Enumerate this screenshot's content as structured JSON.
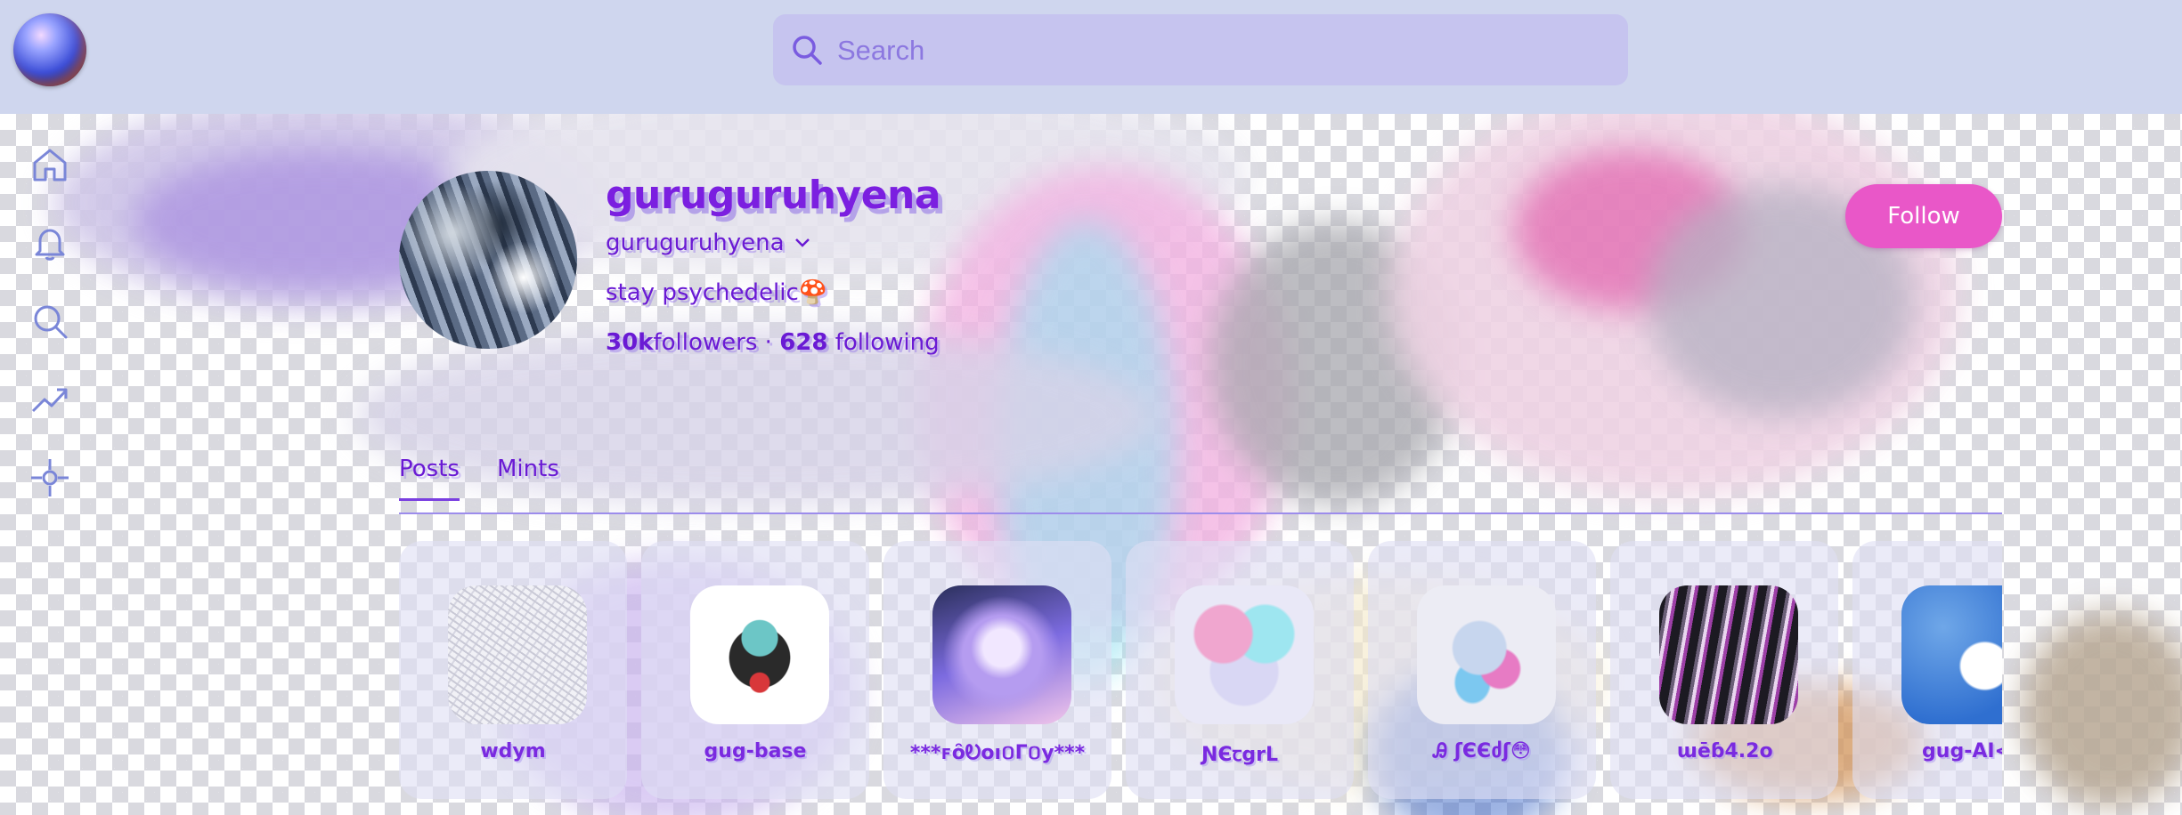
{
  "search": {
    "placeholder": "Search"
  },
  "sidebar": {
    "items": [
      {
        "icon": "home-icon"
      },
      {
        "icon": "bell-icon"
      },
      {
        "icon": "search-icon"
      },
      {
        "icon": "trending-icon"
      },
      {
        "icon": "crosshair-icon"
      }
    ]
  },
  "profile": {
    "display_name": "guruguruhyena",
    "handle": "guruguruhyena",
    "bio": "stay psychedelic🍄",
    "followers_count": "30k",
    "followers_label": "followers",
    "separator": "·",
    "following_count": "628",
    "following_label": "following",
    "follow_label": "Follow"
  },
  "tabs": [
    {
      "label": "Posts",
      "active": true
    },
    {
      "label": "Mints",
      "active": false
    }
  ],
  "cards": [
    {
      "name": "wdym"
    },
    {
      "name": "gug-base"
    },
    {
      "name": "***ꜰȏᎧᴏı០Γ០у***"
    },
    {
      "name": "ƝЄꞇgrL"
    },
    {
      "name": "Ꭿ ʃЄЄძʃ😳"
    },
    {
      "name": "ɯēɓ4.2օ"
    },
    {
      "name": "gug-AI<"
    }
  ],
  "colors": {
    "accent": "#7b1fe0",
    "follow_button": "#e957c8",
    "topbar": "#cfd6ee",
    "search_bg": "#c6c4ef"
  }
}
